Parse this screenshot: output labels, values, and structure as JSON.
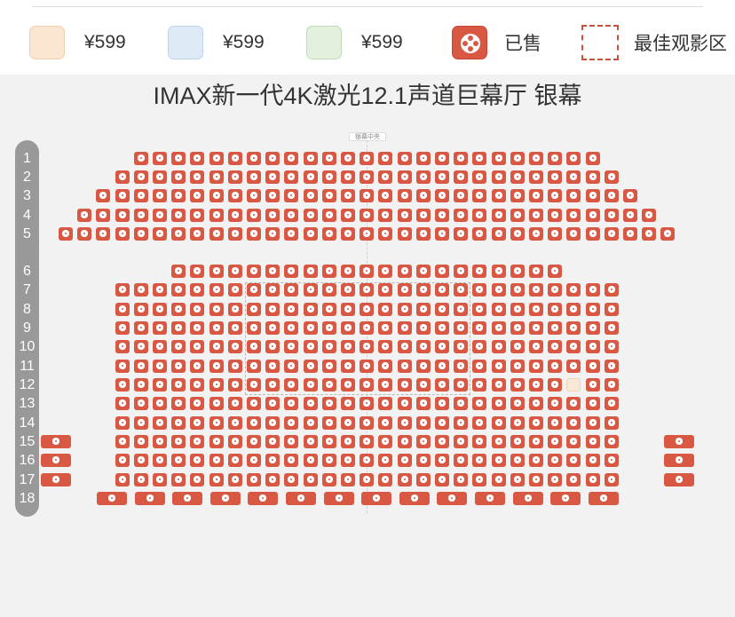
{
  "legend": [
    {
      "kind": "price-tier-a",
      "label": "¥599",
      "color": "#fbe6d2"
    },
    {
      "kind": "price-tier-b",
      "label": "¥599",
      "color": "#deebf6"
    },
    {
      "kind": "price-tier-c",
      "label": "¥599",
      "color": "#e1f1dd"
    },
    {
      "kind": "sold",
      "label": "已售",
      "color": "#d95844"
    },
    {
      "kind": "best-zone",
      "label": "最佳观影区",
      "color": "#c9503f"
    }
  ],
  "hall_title": "IMAX新一代4K激光12.1声道巨幕厅  银幕",
  "screen_center_label": "银幕中央",
  "rows": [
    "1",
    "2",
    "3",
    "4",
    "5",
    "6",
    "7",
    "8",
    "9",
    "10",
    "11",
    "12",
    "13",
    "14",
    "15",
    "16",
    "17",
    "18"
  ],
  "seat_status": {
    "sold_color": "#d95844",
    "available_color": "#f8e8d6",
    "available_seats": [
      {
        "row": "12",
        "seat_index": 27
      }
    ]
  }
}
